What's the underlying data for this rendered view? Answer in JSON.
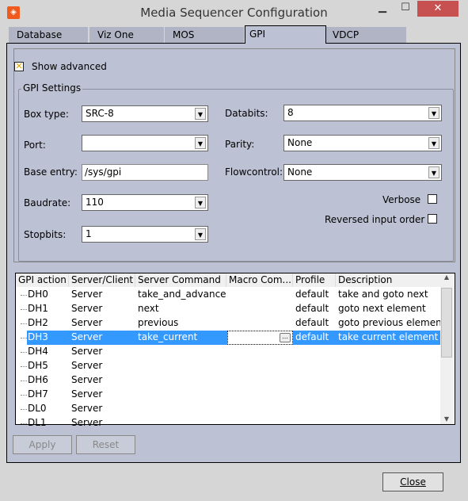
{
  "window": {
    "title": "Media Sequencer Configuration",
    "minimize": "▁",
    "maximize": "☐",
    "close": "✕"
  },
  "tabs": [
    {
      "label": "Database"
    },
    {
      "label": "Viz One"
    },
    {
      "label": "MOS"
    },
    {
      "label": "GPI",
      "active": true
    },
    {
      "label": "VDCP"
    }
  ],
  "show_advanced": {
    "label": "Show advanced",
    "checked": true
  },
  "gpi_settings": {
    "title": "GPI Settings",
    "box_type": {
      "label": "Box type:",
      "value": "SRC-8"
    },
    "port": {
      "label": "Port:",
      "value": ""
    },
    "base_entry": {
      "label": "Base entry:",
      "value": "/sys/gpi"
    },
    "baudrate": {
      "label": "Baudrate:",
      "value": "110"
    },
    "stopbits": {
      "label": "Stopbits:",
      "value": "1"
    },
    "databits": {
      "label": "Databits:",
      "value": "8"
    },
    "parity": {
      "label": "Parity:",
      "value": "None"
    },
    "flowcontrol": {
      "label": "Flowcontrol:",
      "value": "None"
    },
    "verbose": {
      "label": "Verbose",
      "checked": false
    },
    "reversed": {
      "label": "Reversed input order",
      "checked": false
    }
  },
  "table": {
    "columns": [
      "GPI action",
      "Server/Client",
      "Server Command",
      "Macro Com...",
      "Profile",
      "Description"
    ],
    "rows": [
      [
        "DH0",
        "Server",
        "take_and_advance",
        "",
        "default",
        "take and goto next"
      ],
      [
        "DH1",
        "Server",
        "next",
        "",
        "default",
        "goto next element"
      ],
      [
        "DH2",
        "Server",
        "previous",
        "",
        "default",
        "goto previous element"
      ],
      [
        "DH3",
        "Server",
        "take_current",
        "",
        "default",
        "take current element"
      ],
      [
        "DH4",
        "Server",
        "",
        "",
        "",
        ""
      ],
      [
        "DH5",
        "Server",
        "",
        "",
        "",
        ""
      ],
      [
        "DH6",
        "Server",
        "",
        "",
        "",
        ""
      ],
      [
        "DH7",
        "Server",
        "",
        "",
        "",
        ""
      ],
      [
        "DL0",
        "Server",
        "",
        "",
        "",
        ""
      ],
      [
        "DL1",
        "Server",
        "",
        "",
        "",
        ""
      ]
    ],
    "selected_row": 3,
    "ellipsis": "..."
  },
  "buttons": {
    "apply": "Apply",
    "reset": "Reset",
    "close": "Close"
  },
  "colors": {
    "selection": "#3399ff",
    "panel": "#bcc1d3",
    "close_window": "#c75050"
  }
}
